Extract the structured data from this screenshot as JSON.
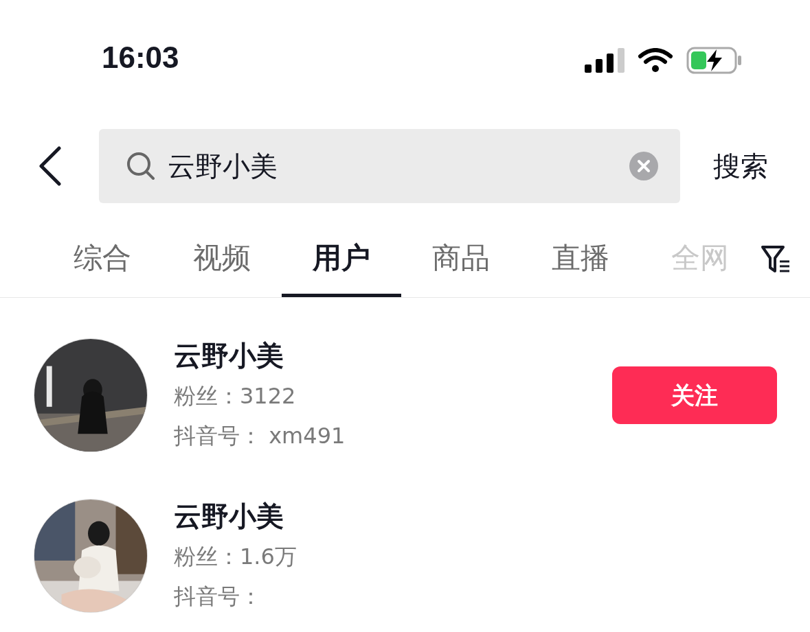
{
  "status_bar": {
    "time": "16:03"
  },
  "search": {
    "value": "云野小美",
    "submit": "搜索"
  },
  "tabs": [
    {
      "label": "综合",
      "selected": false
    },
    {
      "label": "视频",
      "selected": false
    },
    {
      "label": "用户",
      "selected": true
    },
    {
      "label": "商品",
      "selected": false
    },
    {
      "label": "直播",
      "selected": false
    },
    {
      "label": "全网",
      "selected": false
    }
  ],
  "users": [
    {
      "name": "云野小美",
      "fans": "粉丝：3122",
      "account": "抖音号： xm491",
      "follow": "关注"
    },
    {
      "name": "云野小美",
      "fans": "粉丝：1.6万",
      "account": "抖音号："
    }
  ]
}
